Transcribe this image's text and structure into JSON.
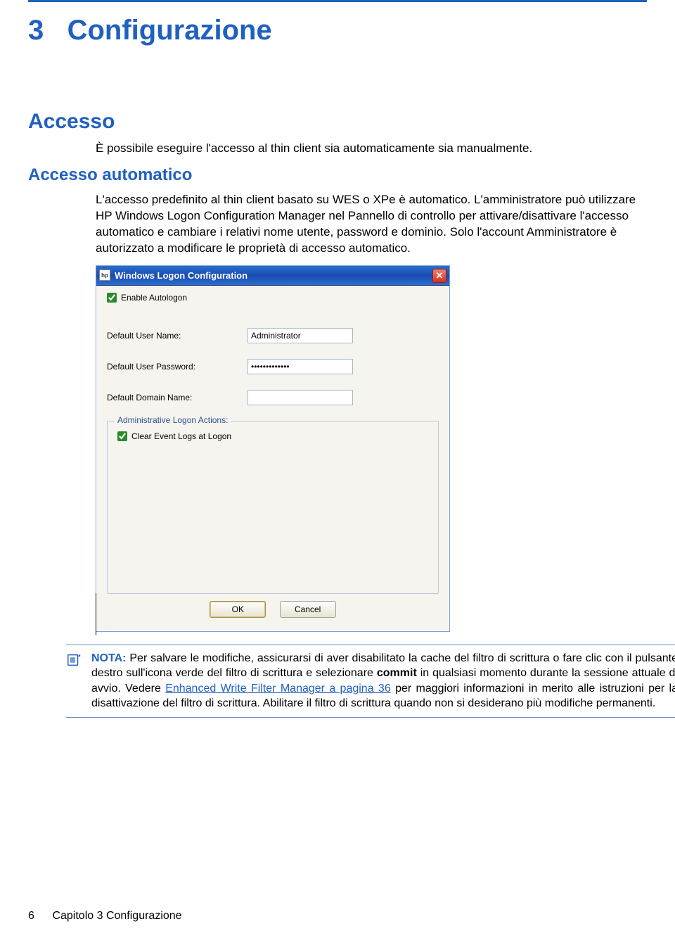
{
  "chapter": {
    "num": "3",
    "title": "Configurazione"
  },
  "section": {
    "h2": "Accesso",
    "intro": "È possibile eseguire l'accesso al thin client sia automaticamente sia manualmente."
  },
  "subsection": {
    "h3": "Accesso automatico",
    "para": "L'accesso predefinito al thin client basato su WES o XPe è automatico. L'amministratore può utilizzare HP Windows Logon Configuration Manager nel Pannello di controllo per attivare/disattivare l'accesso automatico e cambiare i relativi nome utente, password e dominio. Solo l'account Amministratore è autorizzato a modificare le proprietà di accesso automatico."
  },
  "dialog": {
    "sysicon_label": "hp",
    "title": "Windows Logon Configuration",
    "close_glyph": "✕",
    "autologon_label": "Enable Autologon",
    "autologon_checked": true,
    "user_label": "Default User Name:",
    "user_value": "Administrator",
    "pass_label": "Default User Password:",
    "pass_value": "•••••••••••••",
    "domain_label": "Default Domain Name:",
    "domain_value": "",
    "fieldset_legend": "Administrative Logon Actions:",
    "clearlogs_label": "Clear Event Logs at Logon",
    "clearlogs_checked": true,
    "ok_label": "OK",
    "cancel_label": "Cancel"
  },
  "note": {
    "label": "NOTA:",
    "text_before_link": " Per salvare le modifiche, assicurarsi di aver disabilitato la cache del filtro di scrittura o fare clic con il pulsante destro sull'icona verde del filtro di scrittura e selezionare ",
    "bold_commit": "commit",
    "text_mid": " in qualsiasi momento durante la sessione attuale di avvio. Vedere ",
    "link_text": "Enhanced Write Filter Manager a pagina 36",
    "text_after_link": " per maggiori informazioni in merito alle istruzioni per la disattivazione del filtro di scrittura. Abilitare il filtro di scrittura quando non si desiderano più modifiche permanenti."
  },
  "footer": {
    "page_number": "6",
    "chapter_label": "Capitolo 3   Configurazione"
  }
}
